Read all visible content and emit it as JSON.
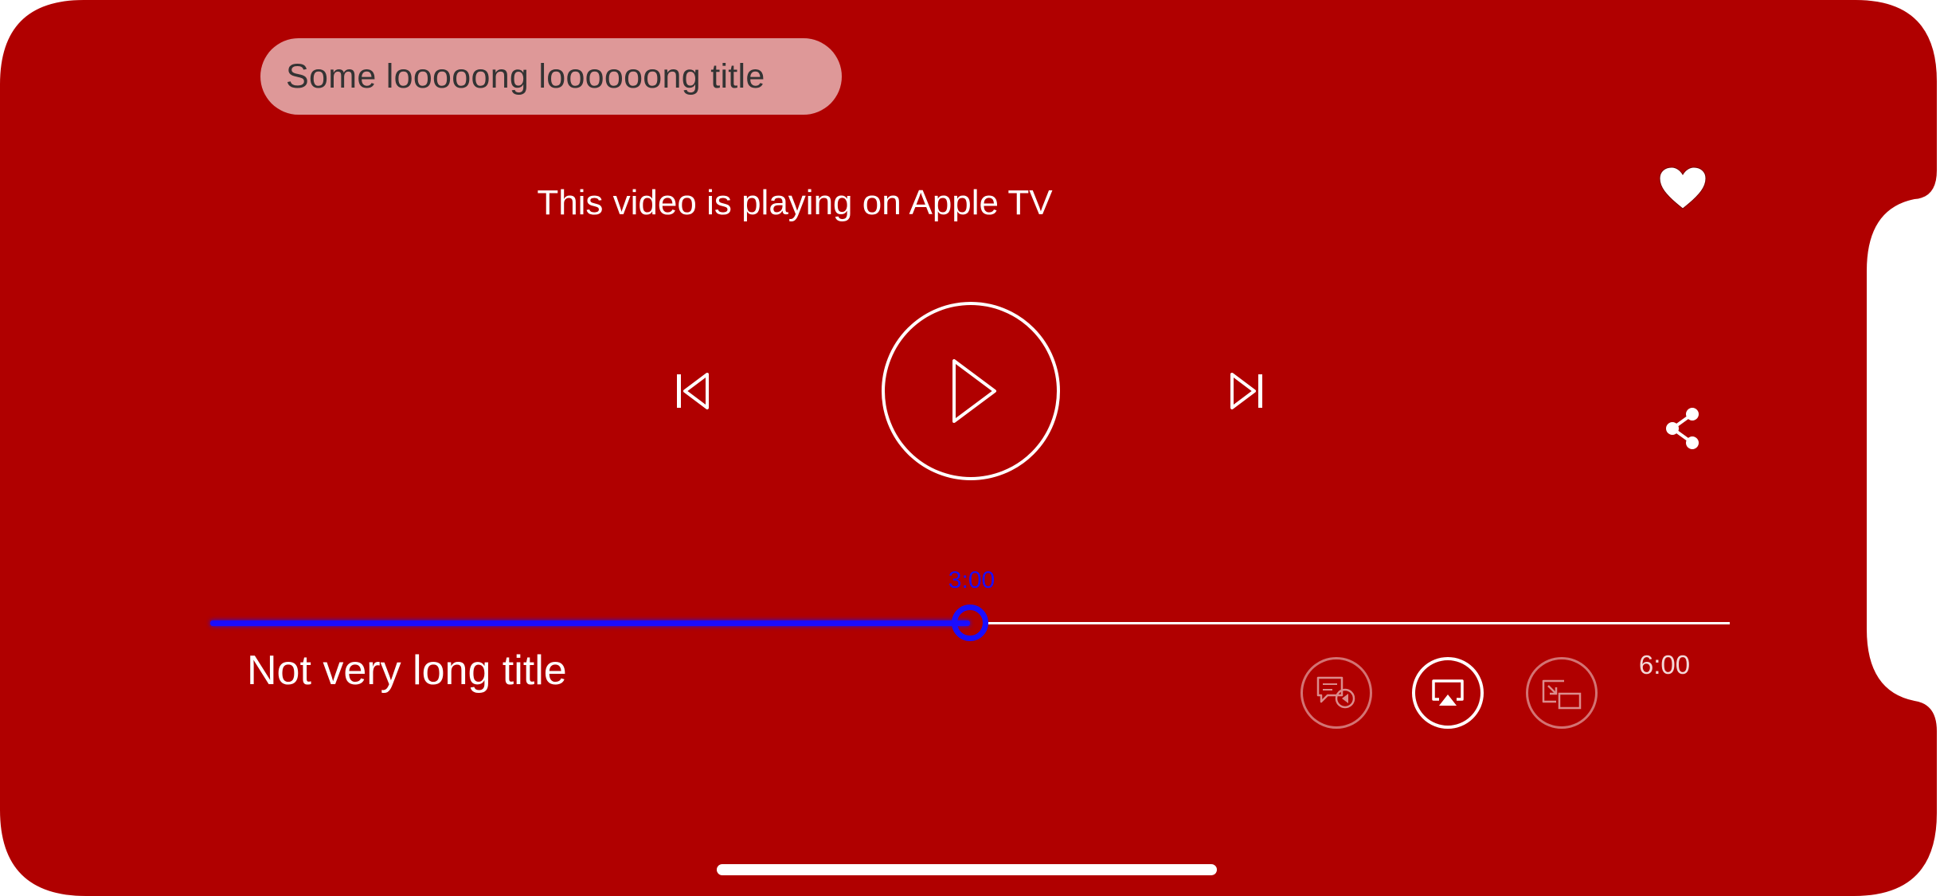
{
  "theme": {
    "background": "#b00000",
    "pill_background": "#de9898",
    "pill_text": "#333333",
    "accent": "#1a0dff",
    "white": "#ffffff"
  },
  "top_title": "Some looooong loooooong title",
  "airplay_status": "This video is playing on Apple TV",
  "controls": {
    "favorite_icon": "heart-icon",
    "share_icon": "share-icon",
    "previous_icon": "skip-back-icon",
    "play_icon": "play-icon",
    "next_icon": "skip-forward-icon"
  },
  "playback": {
    "current_time": "3:00",
    "total_time": "6:00",
    "progress": 0.5
  },
  "bottom_title": "Not very long title",
  "bottom_buttons": {
    "subtitles_icon": "subtitles-audio-icon",
    "airplay_icon": "airplay-icon",
    "pip_icon": "picture-in-picture-icon"
  }
}
